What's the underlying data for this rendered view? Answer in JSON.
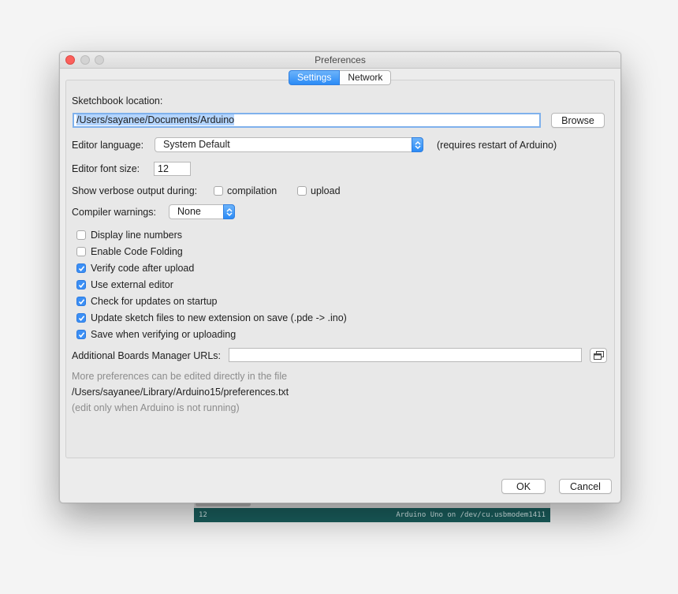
{
  "window": {
    "title": "Preferences"
  },
  "tabs": [
    {
      "label": "Settings",
      "active": true
    },
    {
      "label": "Network",
      "active": false
    }
  ],
  "sketchbook": {
    "label": "Sketchbook location:",
    "value": "/Users/sayanee/Documents/Arduino",
    "browse_label": "Browse"
  },
  "editor_language": {
    "label": "Editor language:",
    "value": "System Default",
    "note": "(requires restart of Arduino)"
  },
  "editor_font_size": {
    "label": "Editor font size:",
    "value": "12"
  },
  "verbose": {
    "label": "Show verbose output during:",
    "compilation_label": "compilation",
    "compilation_checked": false,
    "upload_label": "upload",
    "upload_checked": false
  },
  "compiler_warnings": {
    "label": "Compiler warnings:",
    "value": "None"
  },
  "options": [
    {
      "label": "Display line numbers",
      "checked": false
    },
    {
      "label": "Enable Code Folding",
      "checked": false
    },
    {
      "label": "Verify code after upload",
      "checked": true
    },
    {
      "label": "Use external editor",
      "checked": true
    },
    {
      "label": "Check for updates on startup",
      "checked": true
    },
    {
      "label": "Update sketch files to new extension on save (.pde -> .ino)",
      "checked": true
    },
    {
      "label": "Save when verifying or uploading",
      "checked": true
    }
  ],
  "boards_manager": {
    "label": "Additional Boards Manager URLs:",
    "value": ""
  },
  "info": {
    "line1": "More preferences can be edited directly in the file",
    "path": "/Users/sayanee/Library/Arduino15/preferences.txt",
    "line3": "(edit only when Arduino is not running)"
  },
  "buttons": {
    "ok": "OK",
    "cancel": "Cancel"
  },
  "ide_status": {
    "line": "12",
    "board": "Arduino Uno on /dev/cu.usbmodem1411"
  },
  "colors": {
    "accent": "#2b8bf6",
    "status_bar": "#1a5f5e",
    "close_button": "#fc605c"
  }
}
